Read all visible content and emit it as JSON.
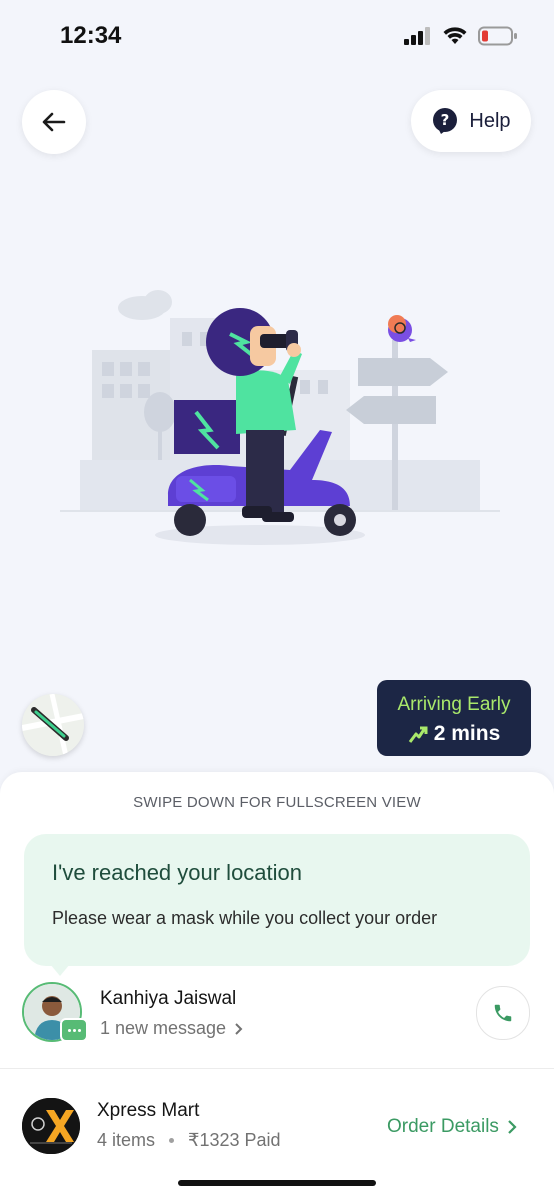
{
  "status_bar": {
    "time": "12:34"
  },
  "header": {
    "help_label": "Help"
  },
  "eta": {
    "status": "Arriving Early",
    "time": "2 mins",
    "accent": "#a9e86b",
    "card_bg": "#1c2645"
  },
  "sheet": {
    "swipe_hint": "SWIPE DOWN FOR FULLSCREEN VIEW",
    "message": {
      "title": "I've reached your location",
      "body": "Please wear a mask while you collect your order"
    },
    "rider": {
      "name": "Kanhiya Jaiswal",
      "new_message": "1 new message"
    },
    "store": {
      "name": "Xpress Mart",
      "items": "4 items",
      "paid": "₹1323 Paid",
      "order_details": "Order Details",
      "logo_text": "Xpress Mart"
    }
  },
  "icons": [
    "back-arrow-icon",
    "help-icon",
    "signal-icon",
    "wifi-icon",
    "battery-icon",
    "trend-up-icon",
    "phone-icon",
    "chat-icon",
    "chevron-right-icon"
  ],
  "colors": {
    "brand_green": "#3b9a63",
    "bubble_bg": "#e8f7ef",
    "background": "#f3f5fb"
  }
}
